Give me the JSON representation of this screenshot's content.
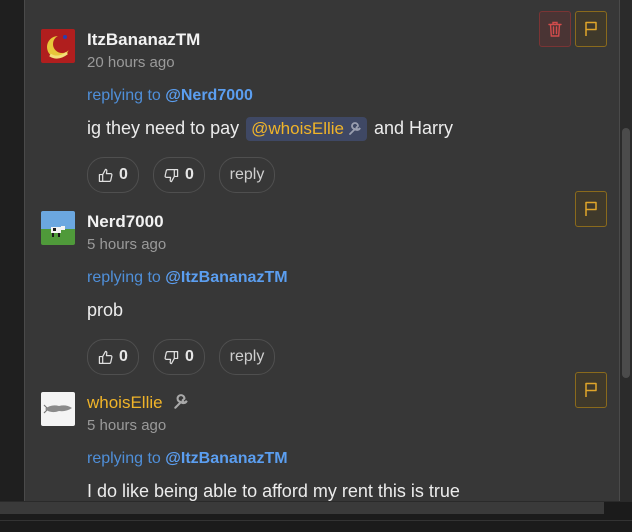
{
  "comments": [
    {
      "username": "ItzBananazTM",
      "time": "20 hours ago",
      "replying_prefix": "replying to ",
      "replying_to": "@Nerd7000",
      "body_before": "ig they need to pay",
      "mention": "@whoisEllie",
      "body_after": "and Harry",
      "likes": "0",
      "dislikes": "0",
      "reply_label": "reply"
    },
    {
      "username": "Nerd7000",
      "time": "5 hours ago",
      "replying_prefix": "replying to ",
      "replying_to": "@ItzBananazTM",
      "body": "prob",
      "likes": "0",
      "dislikes": "0",
      "reply_label": "reply"
    },
    {
      "username": "whoisEllie",
      "time": "5 hours ago",
      "replying_prefix": "replying to ",
      "replying_to": "@ItzBananazTM",
      "body": "I do like being able to afford my rent this is true"
    }
  ],
  "icons": {
    "delete": "trash-icon",
    "flag": "flag-icon",
    "like": "thumbs-up-icon",
    "dislike": "thumbs-down-icon",
    "admin": "wrench-icon"
  },
  "colors": {
    "background": "#373737",
    "username_admin": "#f0b429",
    "link": "#4f8fd9",
    "flag_border": "#8a6a1c",
    "delete_border": "#7a3434"
  }
}
